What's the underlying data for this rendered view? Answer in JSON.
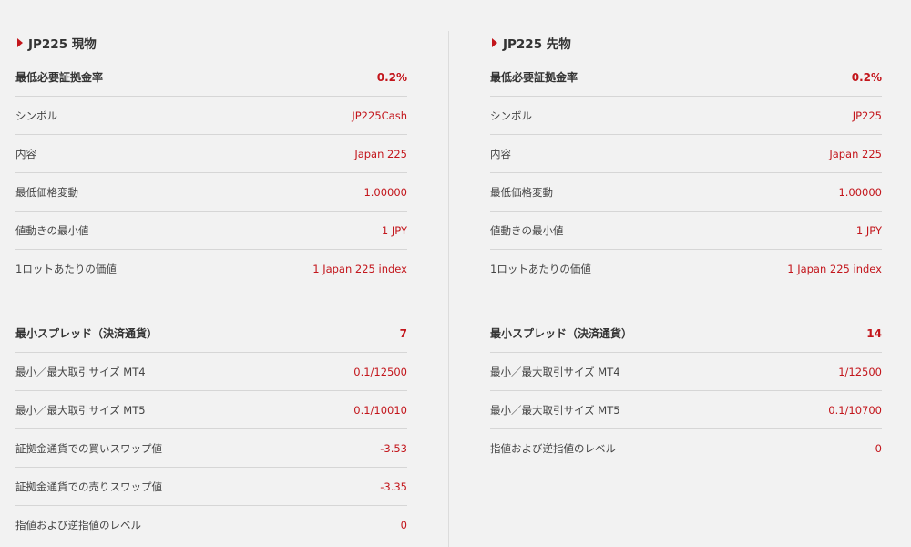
{
  "panels": [
    {
      "title": "JP225 現物",
      "table1": [
        {
          "label": "最低必要証拠金率",
          "value": "0.2%"
        },
        {
          "label": "シンボル",
          "value": "JP225Cash"
        },
        {
          "label": "内容",
          "value": "Japan 225"
        },
        {
          "label": "最低価格変動",
          "value": "1.00000"
        },
        {
          "label": "値動きの最小値",
          "value": "1 JPY"
        },
        {
          "label": "1ロットあたりの価値",
          "value": "1 Japan 225 index"
        }
      ],
      "table2": [
        {
          "label": "最小スプレッド（決済通貨）",
          "value": "7"
        },
        {
          "label": "最小／最大取引サイズ MT4",
          "value": "0.1/12500"
        },
        {
          "label": "最小／最大取引サイズ MT5",
          "value": "0.1/10010"
        },
        {
          "label": "証拠金通貨での買いスワップ値",
          "value": "-3.53"
        },
        {
          "label": "証拠金通貨での売りスワップ値",
          "value": "-3.35"
        },
        {
          "label": "指値および逆指値のレベル",
          "value": "0"
        }
      ]
    },
    {
      "title": "JP225 先物",
      "table1": [
        {
          "label": "最低必要証拠金率",
          "value": "0.2%"
        },
        {
          "label": "シンボル",
          "value": "JP225"
        },
        {
          "label": "内容",
          "value": "Japan 225"
        },
        {
          "label": "最低価格変動",
          "value": "1.00000"
        },
        {
          "label": "値動きの最小値",
          "value": "1 JPY"
        },
        {
          "label": "1ロットあたりの価値",
          "value": "1 Japan 225 index"
        }
      ],
      "table2": [
        {
          "label": "最小スプレッド（決済通貨）",
          "value": "14"
        },
        {
          "label": "最小／最大取引サイズ MT4",
          "value": "1/12500"
        },
        {
          "label": "最小／最大取引サイズ MT5",
          "value": "0.1/10700"
        },
        {
          "label": "指値および逆指値のレベル",
          "value": "0"
        }
      ]
    }
  ],
  "colors": {
    "accent": "#c3161c",
    "background": "#f2f2f2",
    "text": "#444444",
    "rule": "#d6d6d6"
  }
}
